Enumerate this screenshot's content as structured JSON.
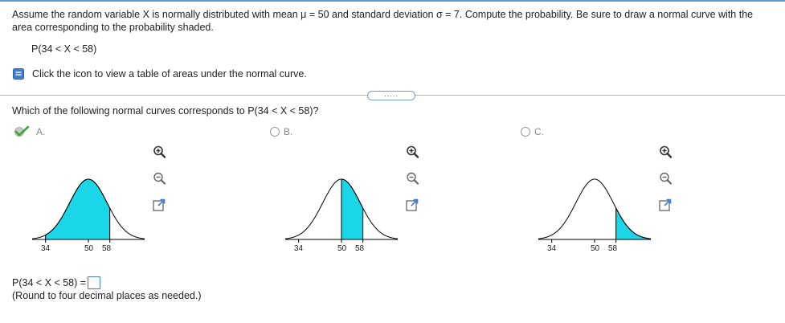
{
  "question": {
    "text": "Assume the random variable X is normally distributed with mean μ = 50 and standard deviation σ = 7. Compute the probability. Be sure to draw a normal curve with the area corresponding to the probability shaded.",
    "probability": "P(34 < X < 58)"
  },
  "table_link": {
    "label": "Click the icon to view a table of areas under the normal curve.",
    "icon": "book-icon"
  },
  "more_button": {
    "label": "....."
  },
  "prompt": "Which of the following normal curves corresponds to P(34 < X < 58)?",
  "options": [
    {
      "letter": "A.",
      "selected": true,
      "ticks": [
        "34",
        "50",
        "58"
      ],
      "shaded": "between 34 and 58"
    },
    {
      "letter": "B.",
      "selected": false,
      "ticks": [
        "34",
        "50",
        "58"
      ],
      "shaded": "between 50 and 58"
    },
    {
      "letter": "C.",
      "selected": false,
      "ticks": [
        "34",
        "50",
        "58"
      ],
      "shaded": "above 58"
    }
  ],
  "zoom_icons": [
    "zoom-in-icon",
    "zoom-out-icon",
    "expand-icon"
  ],
  "answer": {
    "label": "P(34 < X < 58) =",
    "value": ""
  },
  "note": "(Round to four decimal places as needed.)",
  "colors": {
    "shade": "#1ad6e8",
    "accent": "#5b9bd5",
    "check": "#39a935"
  }
}
